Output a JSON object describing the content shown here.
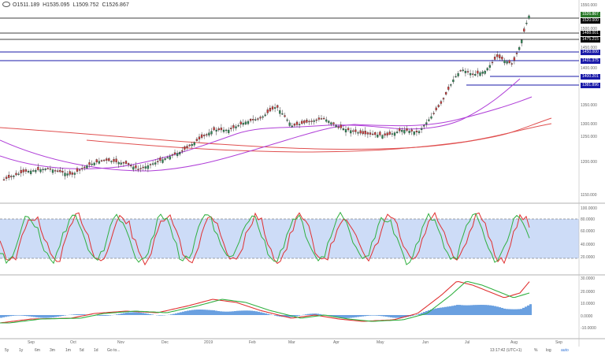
{
  "ohlc": {
    "open": "O1511.189",
    "high": "H1535.095",
    "low": "L1509.752",
    "close": "C1526.867"
  },
  "price_axis": [
    "1550.000",
    "1500.000",
    "1450.000",
    "1400.000",
    "1350.000",
    "1300.000",
    "1250.000",
    "1200.000",
    "1150.000"
  ],
  "price_tags": [
    {
      "text": "1526.867",
      "color": "#2a7a2a"
    },
    {
      "text": "1520.000",
      "color": "#000000"
    },
    {
      "text": "1488.001",
      "color": "#000000"
    },
    {
      "text": "1475.215",
      "color": "#000000"
    },
    {
      "text": "1450.000",
      "color": "#1a1aa8"
    },
    {
      "text": "1431.375",
      "color": "#1a1aa8"
    },
    {
      "text": "1400.201",
      "color": "#1a1aa8"
    },
    {
      "text": "1381.896",
      "color": "#1a1aa8"
    }
  ],
  "stoch_axis": [
    "100.0000",
    "80.0000",
    "60.0000",
    "40.0000",
    "20.0000"
  ],
  "macd_axis": [
    "30.0000",
    "20.0000",
    "10.0000",
    "0.0000",
    "-10.0000"
  ],
  "months": [
    "Sep",
    "Oct",
    "Nov",
    "Dec",
    "2019",
    "Feb",
    "Mar",
    "Apr",
    "May",
    "Jun",
    "Jul",
    "Aug",
    "Sep"
  ],
  "timeframes": [
    "5y",
    "1y",
    "6m",
    "3m",
    "1m",
    "5d",
    "1d",
    "Go to..."
  ],
  "status": {
    "time": "13:17:42 (UTC+1)",
    "percent": "%",
    "log": "log",
    "auto": "auto"
  }
}
